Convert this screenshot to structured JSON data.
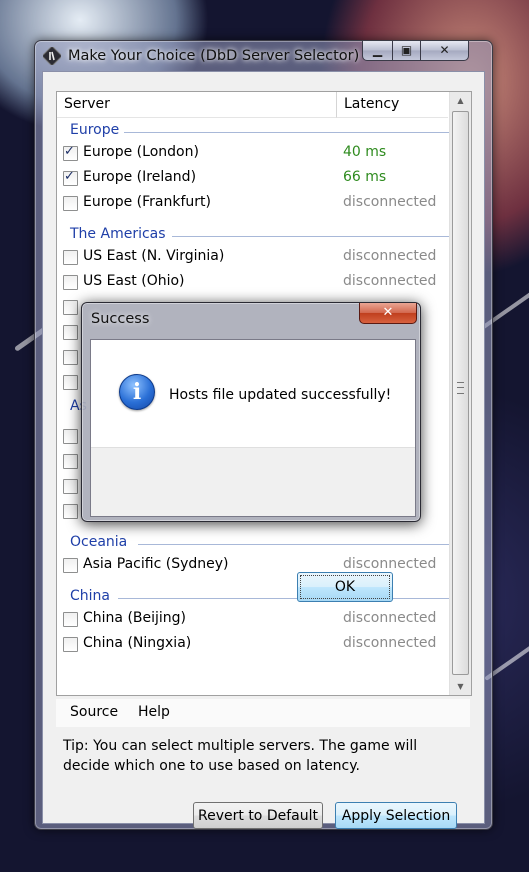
{
  "window": {
    "title": "Make Your Choice (DbD Server Selector)"
  },
  "list": {
    "columns": {
      "server": "Server",
      "latency": "Latency"
    },
    "groups": [
      {
        "name": "Europe",
        "servers": [
          {
            "name": "Europe (London)",
            "latency": "40 ms",
            "checked": true
          },
          {
            "name": "Europe (Ireland)",
            "latency": "66 ms",
            "checked": true
          },
          {
            "name": "Europe (Frankfurt)",
            "latency": "disconnected",
            "checked": false
          }
        ]
      },
      {
        "name": "The Americas",
        "servers": [
          {
            "name": "US East (N. Virginia)",
            "latency": "disconnected",
            "checked": false
          },
          {
            "name": "US East (Ohio)",
            "latency": "disconnected",
            "checked": false
          }
        ]
      },
      {
        "name": "Oceania",
        "servers": [
          {
            "name": "Asia Pacific (Sydney)",
            "latency": "disconnected",
            "checked": false
          }
        ]
      },
      {
        "name": "China",
        "servers": [
          {
            "name": "China (Beijing)",
            "latency": "disconnected",
            "checked": false
          },
          {
            "name": "China (Ningxia)",
            "latency": "disconnected",
            "checked": false
          }
        ]
      }
    ],
    "partial_group_label": "As"
  },
  "menu": {
    "source": "Source",
    "help": "Help"
  },
  "tip": "Tip: You can select multiple servers. The game will decide which one to use based on latency.",
  "buttons": {
    "revert": "Revert to Default",
    "apply": "Apply Selection"
  },
  "dialog": {
    "title": "Success",
    "message": "Hosts file updated successfully!",
    "ok": "OK",
    "close_glyph": "✕",
    "info_glyph": "i"
  },
  "colors": {
    "group_header": "#1f3fa8",
    "latency_ok": "#2e8b1e",
    "latency_disconnected": "#8a8a8a"
  },
  "icons": {
    "app": "dbd-logo-icon",
    "minimize": "minimize-icon",
    "maximize": "maximize-icon",
    "close": "close-icon",
    "info": "info-icon"
  }
}
